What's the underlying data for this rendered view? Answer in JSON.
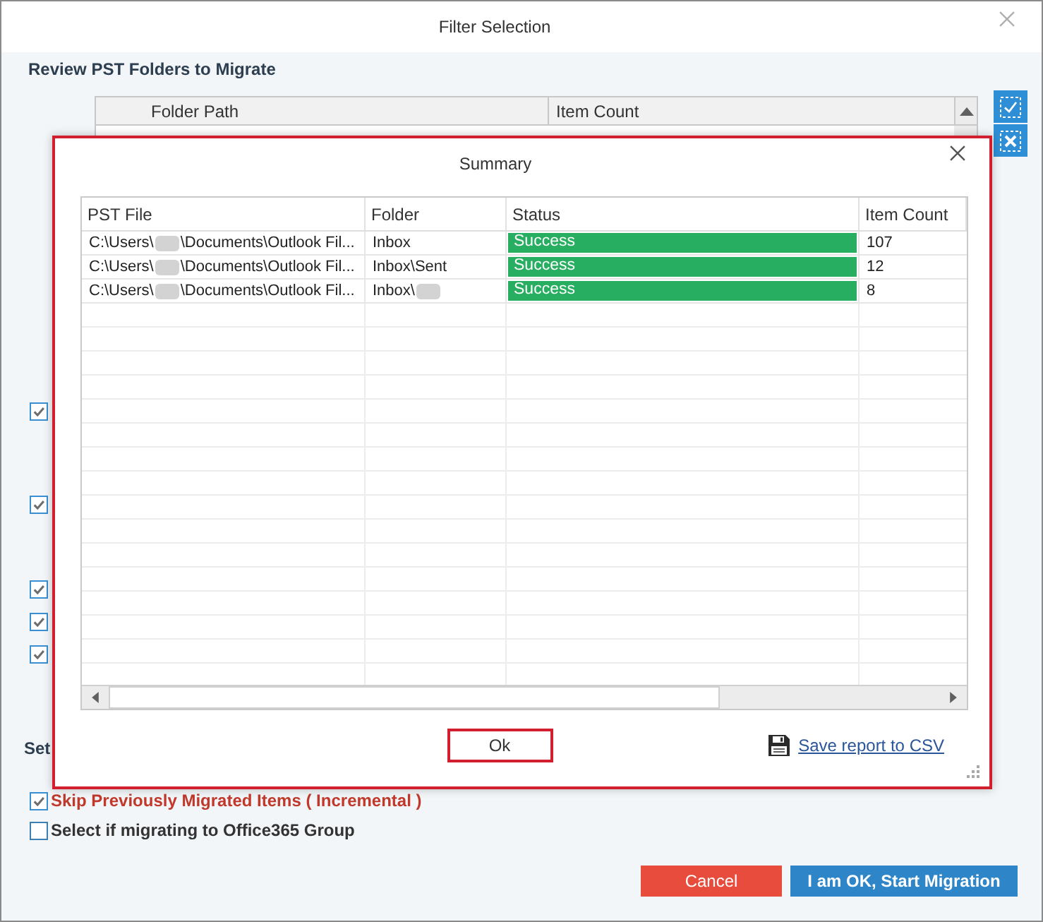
{
  "window": {
    "title": "Filter Selection"
  },
  "review": {
    "heading": "Review PST Folders to Migrate",
    "columns": [
      "Folder Path",
      "Item Count"
    ]
  },
  "side_buttons": [
    {
      "kind": "check_all"
    },
    {
      "kind": "uncheck_all"
    }
  ],
  "options": [
    {
      "checked": true
    },
    {
      "checked": true
    },
    {
      "checked": true
    },
    {
      "checked": true
    },
    {
      "checked": true
    }
  ],
  "settings_heading": "Set",
  "incremental": {
    "label": "Skip Previously Migrated Items ( Incremental )",
    "checked": true
  },
  "group_option": {
    "label": "Select if migrating to Office365 Group",
    "checked": false
  },
  "buttons": [
    {
      "kind": "cancel",
      "label": "Cancel"
    },
    {
      "kind": "primary",
      "label": "I am OK, Start Migration"
    }
  ],
  "summary": {
    "title": "Summary",
    "columns": [
      "PST File",
      "Folder",
      "Status",
      "Item Count"
    ],
    "rows": [
      {
        "pst_file": {
          "before": "C:\\Users\\",
          "redacted": true,
          "after": "\\Documents\\Outlook Fil..."
        },
        "folder": {
          "before": "Inbox"
        },
        "status": {
          "kind": "success",
          "text": "Success"
        },
        "item_count": "107"
      },
      {
        "pst_file": {
          "before": "C:\\Users\\",
          "redacted": true,
          "after": "\\Documents\\Outlook Fil..."
        },
        "folder": {
          "before": "Inbox\\Sent"
        },
        "status": {
          "kind": "success",
          "text": "Success"
        },
        "item_count": "12"
      },
      {
        "pst_file": {
          "before": "C:\\Users\\",
          "redacted": true,
          "after": "\\Documents\\Outlook Fil..."
        },
        "folder": {
          "before": "Inbox\\",
          "redacted": true
        },
        "status": {
          "kind": "success",
          "text": "Success"
        },
        "item_count": "8"
      }
    ],
    "ok_button": "Ok",
    "save_link": "Save report to CSV"
  }
}
